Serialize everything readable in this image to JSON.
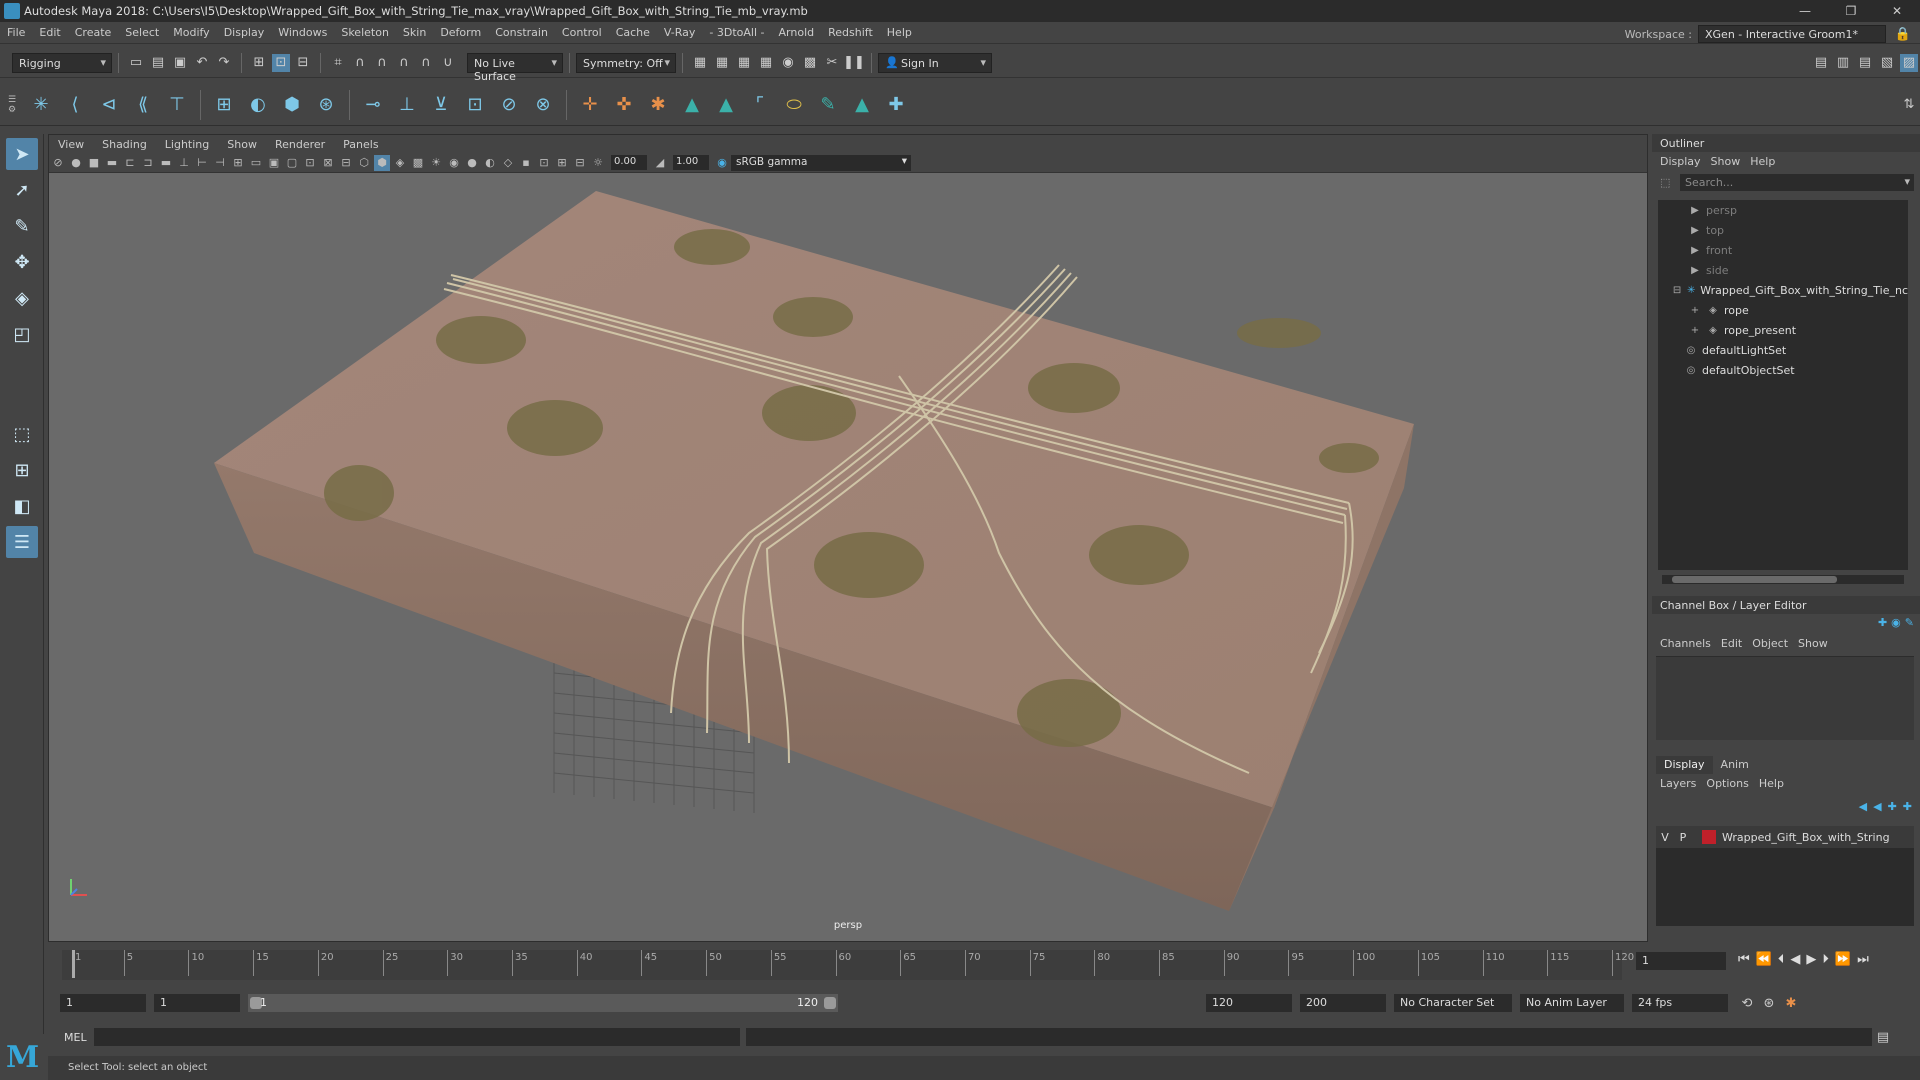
{
  "window": {
    "title": "Autodesk Maya 2018: C:\\Users\\I5\\Desktop\\Wrapped_Gift_Box_with_String_Tie_max_vray\\Wrapped_Gift_Box_with_String_Tie_mb_vray.mb"
  },
  "menubar": [
    "File",
    "Edit",
    "Create",
    "Select",
    "Modify",
    "Display",
    "Windows",
    "Skeleton",
    "Skin",
    "Deform",
    "Constrain",
    "Control",
    "Cache",
    "V-Ray",
    "- 3DtoAll -",
    "Arnold",
    "Redshift",
    "Help"
  ],
  "workspace": {
    "label": "Workspace :",
    "value": "XGen - Interactive Groom1*"
  },
  "status": {
    "mode": "Rigging",
    "live_surface": "No Live Surface",
    "symmetry": "Symmetry: Off",
    "sign_in": "Sign In"
  },
  "viewport": {
    "menus": [
      "View",
      "Shading",
      "Lighting",
      "Show",
      "Renderer",
      "Panels"
    ],
    "exposure": "0.00",
    "gamma_value": "1.00",
    "color_space": "sRGB gamma",
    "camera": "persp"
  },
  "outliner": {
    "title": "Outliner",
    "menus": [
      "Display",
      "Show",
      "Help"
    ],
    "search_placeholder": "Search...",
    "items": [
      {
        "label": "persp",
        "dim": true
      },
      {
        "label": "top",
        "dim": true
      },
      {
        "label": "front",
        "dim": true
      },
      {
        "label": "side",
        "dim": true
      },
      {
        "label": "Wrapped_Gift_Box_with_String_Tie_nc",
        "dim": false
      },
      {
        "label": "rope",
        "dim": false
      },
      {
        "label": "rope_present",
        "dim": false
      },
      {
        "label": "defaultLightSet",
        "dim": false
      },
      {
        "label": "defaultObjectSet",
        "dim": false
      }
    ]
  },
  "channelbox": {
    "title": "Channel Box / Layer Editor",
    "menus": [
      "Channels",
      "Edit",
      "Object",
      "Show"
    ]
  },
  "layers": {
    "tabs": [
      "Display",
      "Anim"
    ],
    "menus": [
      "Layers",
      "Options",
      "Help"
    ],
    "row": {
      "v": "V",
      "p": "P",
      "name": "Wrapped_Gift_Box_with_String"
    }
  },
  "timeline": {
    "ticks": [
      "1",
      "5",
      "10",
      "15",
      "20",
      "25",
      "30",
      "35",
      "40",
      "45",
      "50",
      "55",
      "60",
      "65",
      "70",
      "75",
      "80",
      "85",
      "90",
      "95",
      "100",
      "105",
      "110",
      "115",
      "120"
    ],
    "current_frame": "1"
  },
  "range": {
    "start": "1",
    "playback_start": "1",
    "bar_start": "1",
    "bar_end": "120",
    "playback_end": "120",
    "end": "200",
    "character_set": "No Character Set",
    "anim_layer": "No Anim Layer",
    "fps": "24 fps"
  },
  "cmd": {
    "label": "MEL"
  },
  "help": {
    "text": "Select Tool: select an object"
  }
}
